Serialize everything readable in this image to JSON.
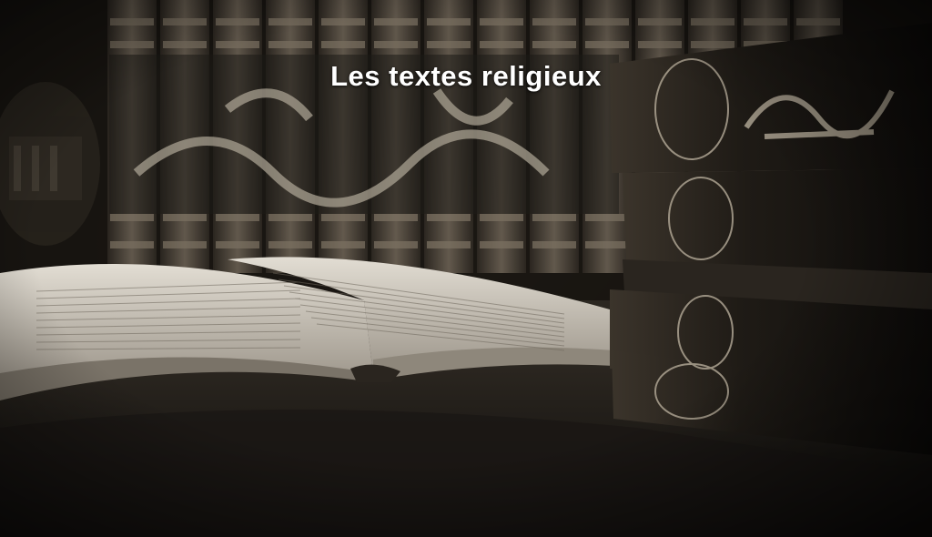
{
  "banner": {
    "title": "Les textes religieux"
  },
  "palette": {
    "sepia_dark": "#1e1b17",
    "sepia_mid": "#5a5044",
    "page_light": "#d8d2c6",
    "text_white": "#ffffff"
  },
  "image": {
    "subject": "sepia-toned-books"
  }
}
